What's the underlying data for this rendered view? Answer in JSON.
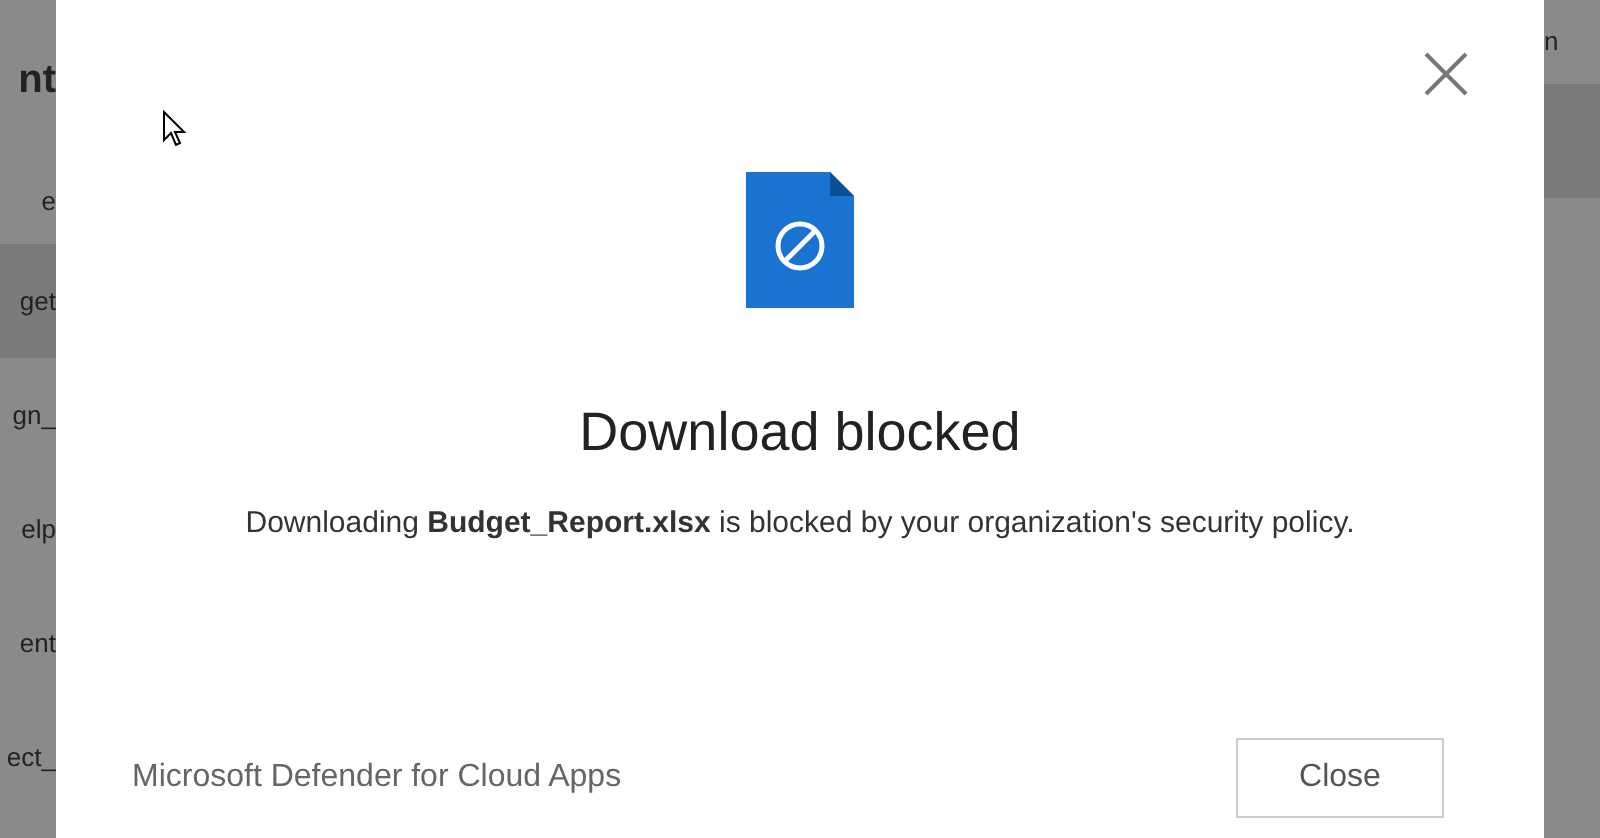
{
  "background_left": [
    {
      "text": "nt",
      "kind": "heading",
      "selected": false
    },
    {
      "text": "e",
      "kind": "column",
      "selected": false
    },
    {
      "text": "get",
      "kind": "row",
      "selected": true
    },
    {
      "text": "gn_",
      "kind": "row",
      "selected": false
    },
    {
      "text": "elp",
      "kind": "row",
      "selected": false
    },
    {
      "text": "ent",
      "kind": "row",
      "selected": false
    },
    {
      "text": "ect_",
      "kind": "row",
      "selected": false
    }
  ],
  "background_right": [
    {
      "text": "n",
      "kind": "column",
      "selected": false
    },
    {
      "kind": "row",
      "selected": true
    }
  ],
  "dialog": {
    "title": "Download blocked",
    "message": "Downloading **Budget_Report.xlsx** is blocked by your organization's security policy.",
    "footer": "Microsoft Defender for Cloud Apps",
    "button": "Close"
  }
}
